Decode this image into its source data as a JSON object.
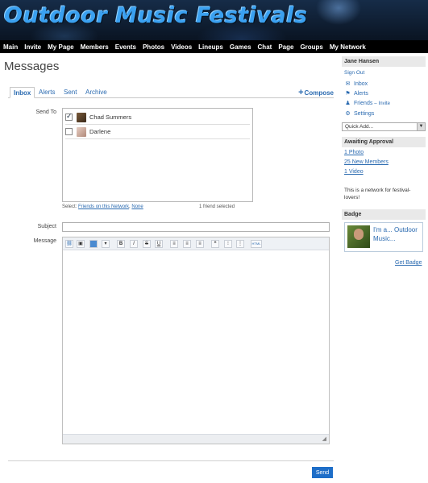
{
  "site": {
    "title": "Outdoor Music Festivals"
  },
  "nav": [
    "Main",
    "Invite",
    "My Page",
    "Members",
    "Events",
    "Photos",
    "Videos",
    "Lineups",
    "Games",
    "Chat",
    "Page",
    "Groups",
    "My Network"
  ],
  "page": {
    "title": "Messages"
  },
  "tabs": [
    {
      "label": "Inbox",
      "active": true
    },
    {
      "label": "Alerts",
      "active": false
    },
    {
      "label": "Sent",
      "active": false
    },
    {
      "label": "Archive",
      "active": false
    }
  ],
  "compose_label": "Compose",
  "form": {
    "send_to_label": "Send To",
    "subject_label": "Subject",
    "message_label": "Message",
    "friends": [
      {
        "name": "Chad Summers",
        "checked": true
      },
      {
        "name": "Darlene",
        "checked": false
      }
    ],
    "select_prefix": "Select:",
    "select_friends": "Friends on this Network",
    "select_none": "None",
    "selected_count": "1 friend selected",
    "subject_value": "",
    "send_label": "Send"
  },
  "toolbar": {
    "buttons": [
      "link-icon",
      "image-icon",
      "media-icon",
      "more-icon",
      "bold-icon",
      "italic-icon",
      "strikethrough-icon",
      "underline-icon",
      "align-left-icon",
      "align-center-icon",
      "align-right-icon",
      "quote-icon",
      "bullet-list-icon",
      "numbered-list-icon",
      "html-icon"
    ]
  },
  "sidebar": {
    "user_name": "Jane Hansen",
    "sign_out": "Sign Out",
    "links": {
      "inbox": "Inbox",
      "alerts": "Alerts",
      "friends": "Friends",
      "invite": "Invite",
      "settings": "Settings"
    },
    "quick_add": "Quick Add...",
    "awaiting_title": "Awaiting Approval",
    "awaiting": [
      "1 Photo",
      "25 New Members",
      "1 Video"
    ],
    "network_desc": "This is a network for festival-lovers!",
    "badge_title": "Badge",
    "badge_text": "I'm a... Outdoor Music...",
    "get_badge": "Get Badge"
  },
  "colors": {
    "link": "#2a6ab0",
    "send_button": "#1e6ec8",
    "nav_bg": "#000000"
  }
}
